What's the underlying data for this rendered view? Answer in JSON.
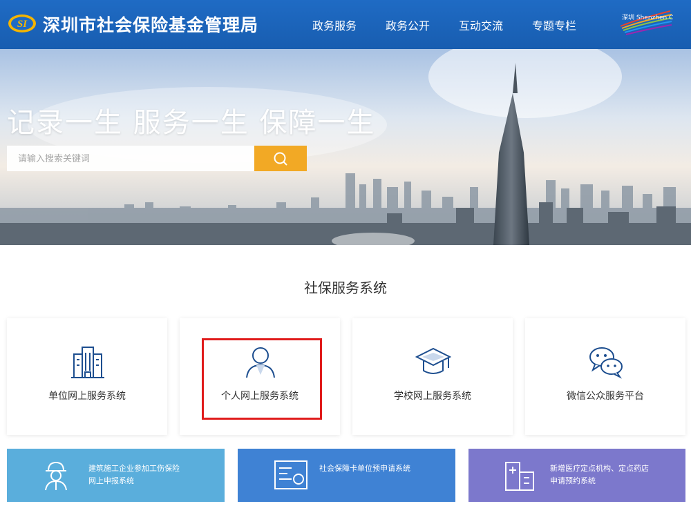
{
  "header": {
    "logo_text": "SI",
    "site_title": "深圳市社会保险基金管理局",
    "nav": [
      "政务服务",
      "政务公开",
      "互动交流",
      "专题专栏"
    ],
    "brand_logo_text": "深圳 Shenzhen China"
  },
  "hero": {
    "slogan": "记录一生  服务一生  保障一生",
    "search_placeholder": "请输入搜索关键词"
  },
  "section": {
    "title": "社保服务系统"
  },
  "cards": [
    {
      "label": "单位网上服务系统",
      "icon": "building-icon"
    },
    {
      "label": "个人网上服务系统",
      "icon": "person-icon"
    },
    {
      "label": "学校网上服务系统",
      "icon": "graduation-cap-icon"
    },
    {
      "label": "微信公众服务平台",
      "icon": "wechat-icon"
    }
  ],
  "banners": [
    {
      "line1": "建筑施工企业参加工伤保险",
      "line2": "网上申报系统",
      "icon": "worker-icon",
      "color": "#5aaedc"
    },
    {
      "line1": "社会保障卡单位预申请系统",
      "line2": "",
      "icon": "card-icon",
      "color": "#3f82d4"
    },
    {
      "line1": "新增医疗定点机构、定点药店",
      "line2": "申请预约系统",
      "icon": "hospital-icon",
      "color": "#7c78cc"
    }
  ],
  "colors": {
    "header": "#1f6bc4",
    "search_button": "#f2a925",
    "highlight": "#e01b1b",
    "icon_blue": "#1d4e8f"
  }
}
